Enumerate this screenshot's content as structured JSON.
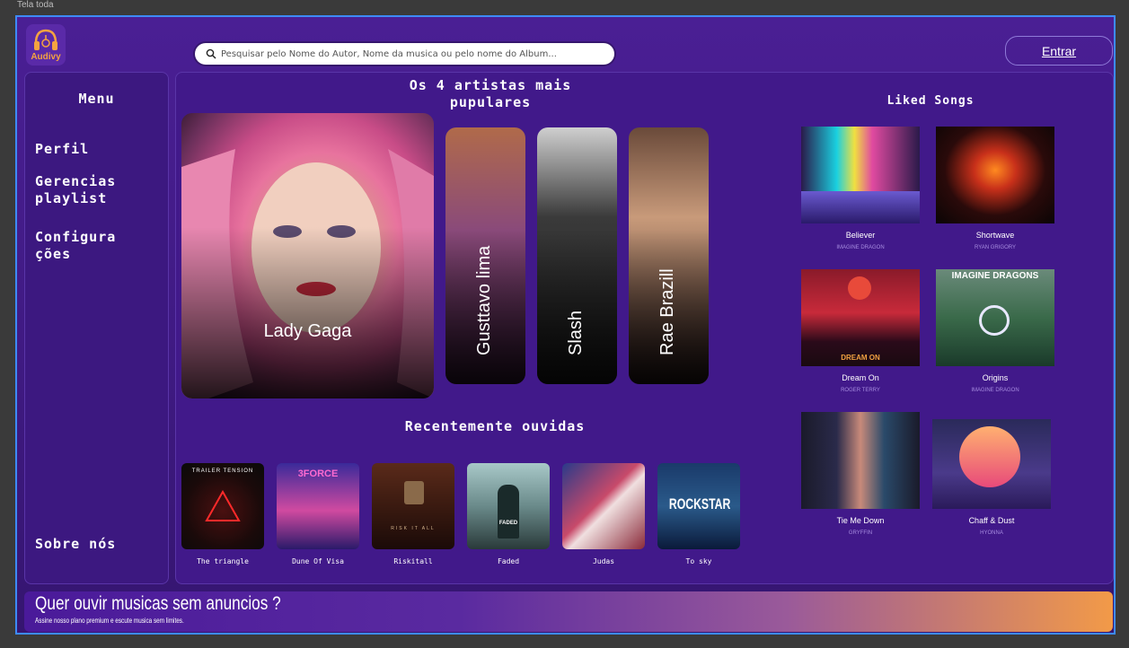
{
  "frame_label": "Tela toda",
  "logo": {
    "text": "Audivy"
  },
  "search": {
    "placeholder": "Pesquisar pelo Nome do Autor, Nome da musica ou pelo nome do Album..."
  },
  "header": {
    "login_label": "Entrar"
  },
  "menu": {
    "title": "Menu",
    "items": [
      {
        "label": "Perfil"
      },
      {
        "label": "Gerencias playlist"
      },
      {
        "label": "Configura ções"
      }
    ],
    "about_label": "Sobre nós"
  },
  "popular": {
    "title": "Os 4 artistas mais pupulares",
    "artists": [
      {
        "name": "Lady Gaga"
      },
      {
        "name": "Gusttavo lima"
      },
      {
        "name": "Slash"
      },
      {
        "name": "Rae Brazill"
      }
    ]
  },
  "recent": {
    "title": "Recentemente ouvidas",
    "items": [
      {
        "title": "The triangle",
        "cover_text": "TRAILER TENSION"
      },
      {
        "title": "Dune Of Visa",
        "cover_text": "3FORCE"
      },
      {
        "title": "Riskitall",
        "cover_text": "RISK IT ALL"
      },
      {
        "title": "Faded",
        "cover_text": "FADED"
      },
      {
        "title": "Judas",
        "cover_text": ""
      },
      {
        "title": "To sky",
        "cover_text": "ROCKSTAR"
      }
    ]
  },
  "liked": {
    "title": "Liked Songs",
    "items": [
      {
        "title": "Believer",
        "artist": "IMAGINE DRAGON",
        "cover_text": ""
      },
      {
        "title": "Shortwave",
        "artist": "RYAN GRIGORY",
        "cover_text": ""
      },
      {
        "title": "Dream On",
        "artist": "ROGER TERRY",
        "cover_text": "DREAM ON"
      },
      {
        "title": "Origins",
        "artist": "IMAGINE DRAGON",
        "cover_text": "IMAGINE DRAGONS"
      },
      {
        "title": "Tie Me Down",
        "artist": "GRYFFIN",
        "cover_text": ""
      },
      {
        "title": "Chaff & Dust",
        "artist": "HYONNA",
        "cover_text": ""
      }
    ]
  },
  "banner": {
    "title": "Quer ouvir musicas sem anuncios ?",
    "subtitle": "Assine nosso plano premium e escute musica sem limites."
  },
  "colors": {
    "accent": "#f5a340",
    "frame_border": "#3d8bff",
    "background": "#41198a"
  }
}
